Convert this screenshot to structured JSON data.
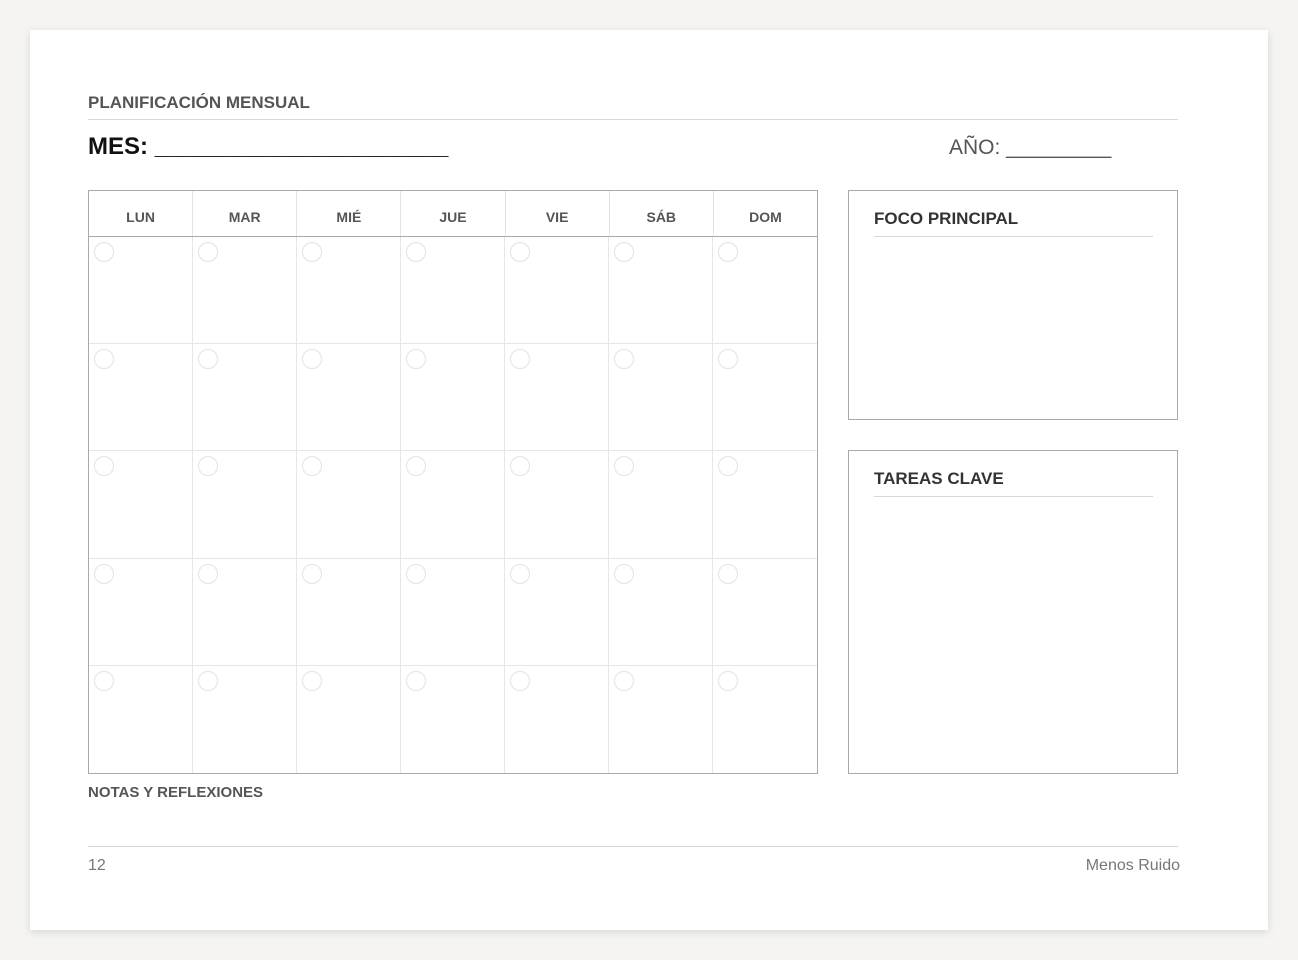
{
  "header": {
    "section_title": "PLANIFICACIÓN MENSUAL",
    "month_label": "MES: ______________________",
    "year_label": "AÑO: _________"
  },
  "calendar": {
    "weekdays": [
      "LUN",
      "MAR",
      "MIÉ",
      "JUE",
      "VIE",
      "SÁB",
      "DOM"
    ],
    "weeks": 5
  },
  "panels": {
    "focus_title": "FOCO PRINCIPAL",
    "tasks_title": "TAREAS CLAVE"
  },
  "notes": {
    "title": "NOTAS Y REFLEXIONES"
  },
  "footer": {
    "page_number": "12",
    "brand": "Menos Ruido"
  },
  "colors": {
    "page_background": "#ffffff",
    "desk_background": "#f5f4f0",
    "border": "#a9a9a9",
    "heading_text": "#555555"
  }
}
